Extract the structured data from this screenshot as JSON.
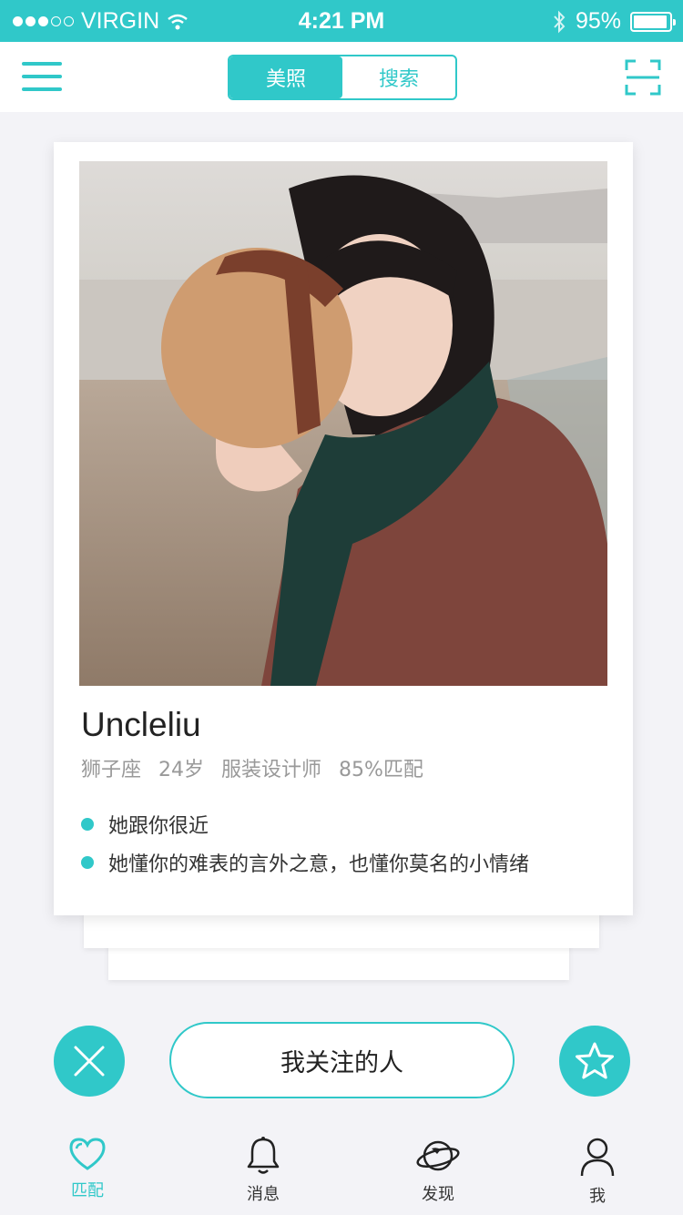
{
  "status_bar": {
    "carrier": "VIRGIN",
    "time": "4:21 PM",
    "battery": "95%",
    "battery_level": 0.95,
    "signal_bars_filled": 3,
    "signal_bars_total": 5
  },
  "nav": {
    "menu_icon": "hamburger-icon",
    "segments": [
      {
        "label": "美照",
        "active": true
      },
      {
        "label": "搜索",
        "active": false
      }
    ],
    "scan_icon": "scan-icon"
  },
  "profile": {
    "name": "Uncleliu",
    "zodiac": "狮子座",
    "age": "24岁",
    "job": "服装设计师",
    "match": "85%匹配",
    "bullets": [
      "她跟你很近",
      "她懂你的难表的言外之意，也懂你莫名的小情绪"
    ]
  },
  "actions": {
    "dislike_icon": "close-icon",
    "follow_label": "我关注的人",
    "favorite_icon": "star-icon"
  },
  "tabs": [
    {
      "label": "匹配",
      "icon": "heart-icon",
      "active": true
    },
    {
      "label": "消息",
      "icon": "bell-icon",
      "active": false
    },
    {
      "label": "发现",
      "icon": "planet-icon",
      "active": false
    },
    {
      "label": "我",
      "icon": "user-icon",
      "active": false
    }
  ],
  "colors": {
    "accent": "#30c8c9",
    "background": "#f3f3f7"
  }
}
